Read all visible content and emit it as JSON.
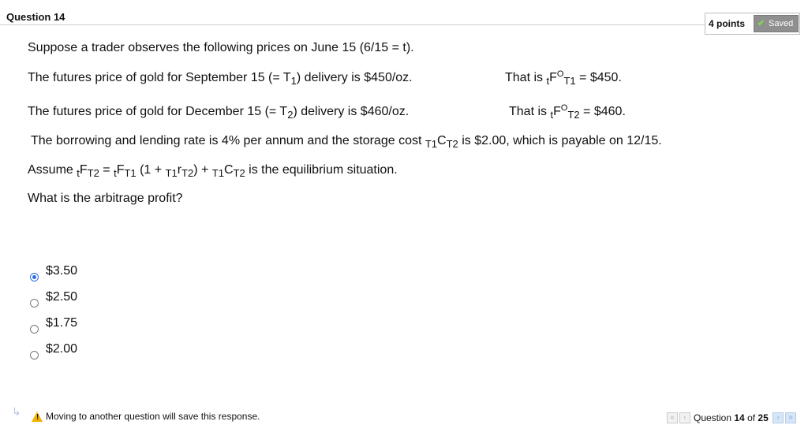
{
  "header": {
    "question_title": "Question 14",
    "points": "4 points",
    "saved_label": "Saved",
    "check_icon": "check-icon"
  },
  "question": {
    "line1": "Suppose a trader observes the following prices on June 15 (6/15 = t).",
    "line2_left": {
      "pre": "The futures price of gold for September 15 (= T",
      "sub": "1",
      "post": ") delivery is $450/oz."
    },
    "line2_right": {
      "pre": "That is ",
      "t": "t",
      "F": "F",
      "sup": "O",
      "T": "T1",
      "post": " = $450."
    },
    "line3_left": {
      "pre": "The futures price of gold for December 15 (= T",
      "sub": "2",
      "post": ") delivery is $460/oz."
    },
    "line3_right": {
      "pre": "That is ",
      "t": "t",
      "F": "F",
      "sup": "O",
      "T": "T2",
      "post": " = $460."
    },
    "line4": {
      "pre": "The borrowing and lending rate is 4% per annum and the storage cost ",
      "a": "T1",
      "C": "C",
      "b": "T2",
      "post": " is $2.00, which is payable on 12/15."
    },
    "line5": {
      "pre": "Assume ",
      "t1": "t",
      "F1": "F",
      "T2a": "T2",
      "eq": " = ",
      "t2": "t",
      "F2": "F",
      "T1a": "T1",
      "mid": " (1 + ",
      "T1b": "T1",
      "r": "r",
      "T2b": "T2",
      "plus": ") + ",
      "T1c": "T1",
      "C": "C",
      "T2c": "T2",
      "post": " is the equilibrium situation."
    },
    "line6": "What is the arbitrage profit?"
  },
  "options": [
    {
      "label": "$3.50",
      "selected": true
    },
    {
      "label": "$2.50",
      "selected": false
    },
    {
      "label": "$1.75",
      "selected": false
    },
    {
      "label": "$2.00",
      "selected": false
    }
  ],
  "footer": {
    "warning": "Moving to another question will save this response.",
    "question_label": "Question ",
    "current": "14",
    "of_label": " of ",
    "total": "25"
  },
  "colors": {
    "radio_selected": "#2f6ee6",
    "saved_badge": "#8f8f8f",
    "warning": "#f1b400"
  }
}
